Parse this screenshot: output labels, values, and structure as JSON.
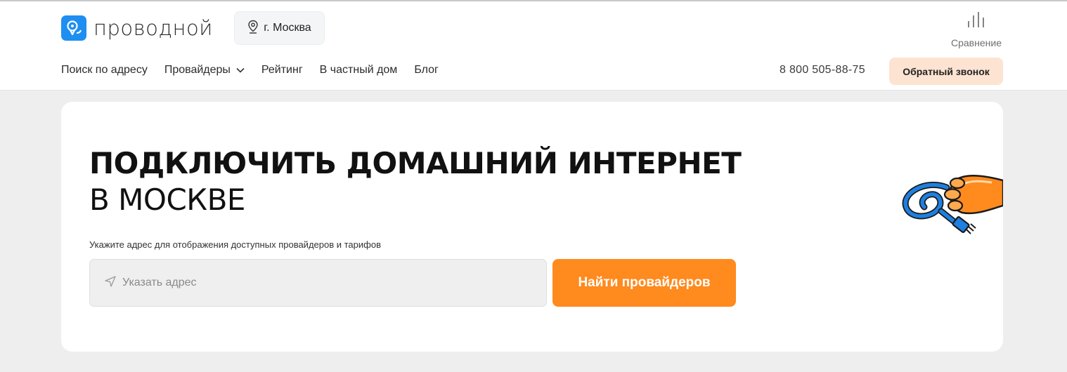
{
  "header": {
    "logo_text": "проводной",
    "city_label": "г. Москва",
    "compare_label": "Сравнение",
    "phone": "8 800 505-88-75",
    "callback_label": "Обратный звонок"
  },
  "nav": {
    "items": [
      {
        "label": "Поиск по адресу"
      },
      {
        "label": "Провайдеры"
      },
      {
        "label": "Рейтинг"
      },
      {
        "label": "В частный дом"
      },
      {
        "label": "Блог"
      }
    ]
  },
  "hero": {
    "title": "ПОДКЛЮЧИТЬ ДОМАШНИЙ ИНТЕРНЕТ",
    "subtitle": "В МОСКВЕ",
    "hint": "Укажите адрес для отображения доступных провайдеров и тарифов",
    "address_placeholder": "Указать адрес",
    "address_value": "",
    "search_label": "Найти провайдеров"
  },
  "colors": {
    "brand_blue": "#1e8ff0",
    "accent_orange": "#ff8a1e",
    "callback_bg": "#fde3d1"
  },
  "icons": [
    "logo-mark-icon",
    "location-pin-icon",
    "compare-bars-icon",
    "chevron-down-icon",
    "send-arrow-icon",
    "mascot-paw-cable-icon"
  ]
}
